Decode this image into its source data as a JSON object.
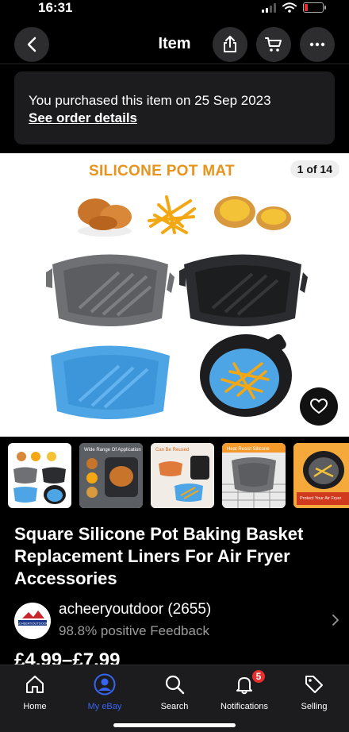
{
  "status_bar": {
    "time": "16:31",
    "battery_color": "#e5302d"
  },
  "header": {
    "title": "Item",
    "back_icon": "chevron-left-icon",
    "share_icon": "share-icon",
    "cart_icon": "cart-icon",
    "more_icon": "more-horizontal-icon"
  },
  "banner": {
    "text": "You purchased this item on 25 Sep 2023",
    "link": "See order details"
  },
  "gallery": {
    "image_title": "SILICONE POT MAT",
    "counter": "1 of 14",
    "favorite_icon": "heart-icon"
  },
  "thumbnails": {
    "count_visible": 6,
    "selected_index": 0,
    "items": [
      {
        "caption": ""
      },
      {
        "caption": "Wide Range Of Application"
      },
      {
        "caption": "Can Be Reused"
      },
      {
        "caption": "Heat Resist Silicone"
      },
      {
        "caption": "Protect Your Air Fryer"
      },
      {
        "caption": ""
      }
    ]
  },
  "product": {
    "title": "Square Silicone Pot Baking Basket Replacement Liners For Air Fryer Accessories",
    "price": "£4.99–£7.99"
  },
  "seller": {
    "name": "acheeryoutdoor (2655)",
    "feedback": "98.8% positive Feedback",
    "avatar_text": "ACHEERYOUTDOOR"
  },
  "bottom_nav": {
    "items": [
      {
        "label": "Home",
        "icon": "home-icon"
      },
      {
        "label": "My eBay",
        "icon": "user-icon"
      },
      {
        "label": "Search",
        "icon": "search-icon"
      },
      {
        "label": "Notifications",
        "icon": "bell-icon",
        "badge": "5"
      },
      {
        "label": "Selling",
        "icon": "tag-icon"
      }
    ],
    "active": "My eBay",
    "active_color": "#3665f3"
  }
}
